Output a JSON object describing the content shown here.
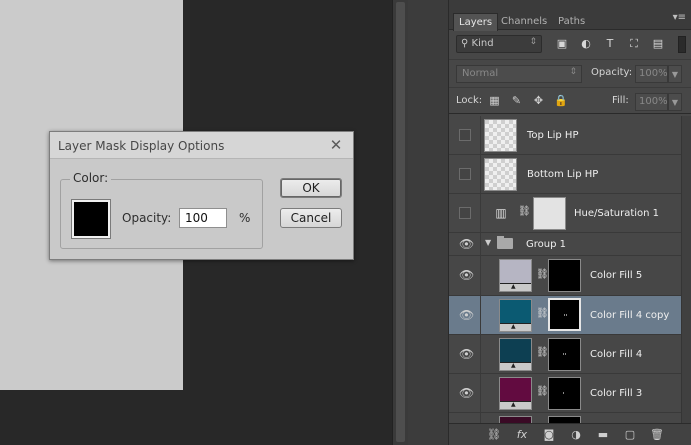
{
  "dialog": {
    "title": "Layer Mask Display Options",
    "color_group_label": "Color:",
    "color_swatch": "#000000",
    "opacity_label": "Opacity:",
    "opacity_value": "100",
    "percent_sign": "%",
    "ok_label": "OK",
    "cancel_label": "Cancel",
    "close_glyph": "✕"
  },
  "panel": {
    "tabs": [
      {
        "label": "Layers",
        "active": true
      },
      {
        "label": "Channels",
        "active": false
      },
      {
        "label": "Paths",
        "active": false
      }
    ],
    "menu_glyph": "▾≡",
    "filter": {
      "kind_label": "Kind",
      "kind_glyph": "⚲",
      "dropdown_glyph": "⇕",
      "icon_glyphs": [
        "▣",
        "◐",
        "T",
        "⛶",
        "▤"
      ]
    },
    "blend": {
      "mode": "Normal",
      "dropdown_glyph": "⇕",
      "opacity_label": "Opacity:",
      "opacity_value": "100%",
      "fill_label": "Fill:",
      "fill_value": "100%",
      "arrow_glyph": "▼"
    },
    "lock": {
      "label": "Lock:",
      "icon_glyphs": [
        "▦",
        "✎",
        "✥",
        "🔒"
      ]
    },
    "layers": [
      {
        "name": "Top Lip HP",
        "type": "pixel",
        "visible": false
      },
      {
        "name": "Bottom Lip HP",
        "type": "pixel",
        "visible": false
      },
      {
        "name": "Hue/Saturation 1",
        "type": "adjustment",
        "visible": false
      },
      {
        "name": "Group 1",
        "type": "group",
        "visible": true
      },
      {
        "name": "Color Fill 5",
        "type": "fill",
        "visible": true,
        "color": "#b6b5c3"
      },
      {
        "name": "Color Fill 4 copy",
        "type": "fill",
        "visible": true,
        "color": "#0b5a72",
        "selected": true
      },
      {
        "name": "Color Fill 4",
        "type": "fill",
        "visible": true,
        "color": "#0d3f52"
      },
      {
        "name": "Color Fill 3",
        "type": "fill",
        "visible": true,
        "color": "#620b40"
      },
      {
        "name": "",
        "type": "fill",
        "visible": true,
        "color": "#3a0a25"
      }
    ],
    "glyphs": {
      "eye": "👁",
      "chain": "⛓",
      "disclose": "▼",
      "adjustment": "▥"
    },
    "bottom_icons": [
      "⛓",
      "fx",
      "◙",
      "◑",
      "▬",
      "▢",
      "🗑"
    ]
  }
}
